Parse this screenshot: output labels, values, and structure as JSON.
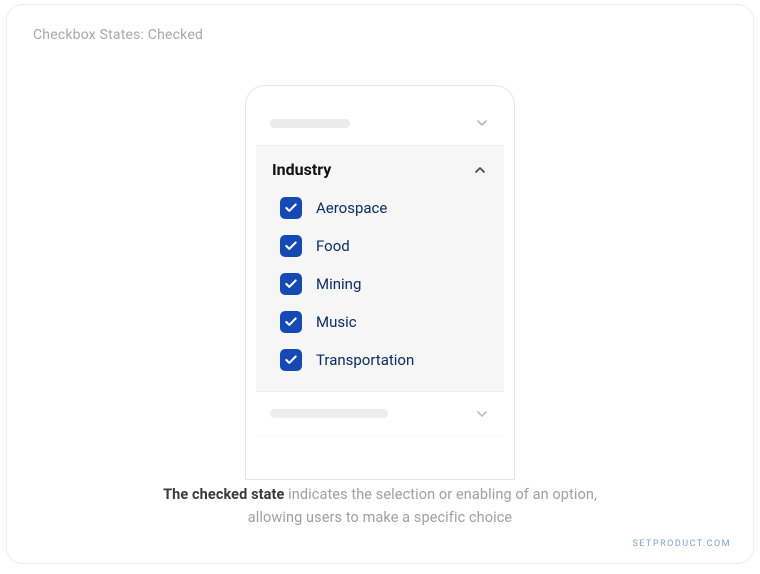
{
  "header": {
    "label": "Checkbox States: Checked"
  },
  "panel": {
    "section_title": "Industry",
    "items": [
      {
        "label": "Aerospace",
        "checked": true
      },
      {
        "label": "Food",
        "checked": true
      },
      {
        "label": "Mining",
        "checked": true
      },
      {
        "label": "Music",
        "checked": true
      },
      {
        "label": "Transportation",
        "checked": true
      }
    ]
  },
  "caption": {
    "strong": "The checked state",
    "rest_line1": " indicates the selection or enabling of an option,",
    "line2": "allowing users to make a specific choice"
  },
  "watermark": "SETPRODUCT.COM",
  "colors": {
    "checkbox_fill": "#1549b3",
    "label_text": "#0b2e63"
  }
}
